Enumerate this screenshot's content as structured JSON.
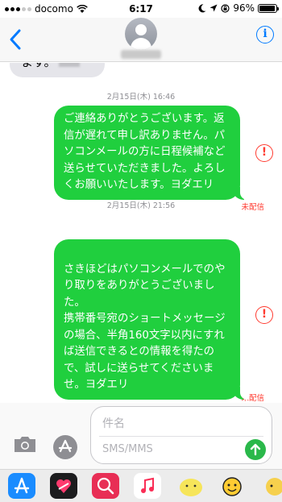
{
  "status_bar": {
    "carrier": "docomo",
    "time": "6:17",
    "battery": "96%"
  },
  "thread": {
    "received_fragment": "ます。",
    "messages": [
      {
        "date": "2月15日(木)",
        "time": "16:46",
        "text": "ご連絡ありがとうございます。返信が遅れて申し訳ありません。パソコンメールの方に日程候補など送らせていただきました。よろしくお願いいたします。ヨダエリ",
        "status": "未配信"
      },
      {
        "date": "2月15日(木)",
        "time": "21:56",
        "text": "さきほどはパソコンメールでのやり取りをありがとうございました。\n携帯番号宛のショートメッセージの場合、半角160文字以内にすれば送信できるとの情報を得たので、試しに送らせてくださいませ。ヨダエリ",
        "status": "未配信"
      }
    ]
  },
  "compose": {
    "subject_placeholder": "件名",
    "message_placeholder": "SMS/MMS"
  },
  "icons": {
    "back": "chevron-left-icon",
    "info": "info-icon",
    "error": "exclamation-icon",
    "camera": "camera-icon",
    "appstore": "app-store-icon",
    "send": "arrow-up-icon"
  },
  "colors": {
    "sent_bubble": "#20cf3e",
    "tint": "#007aff",
    "error": "#ff3b30"
  }
}
